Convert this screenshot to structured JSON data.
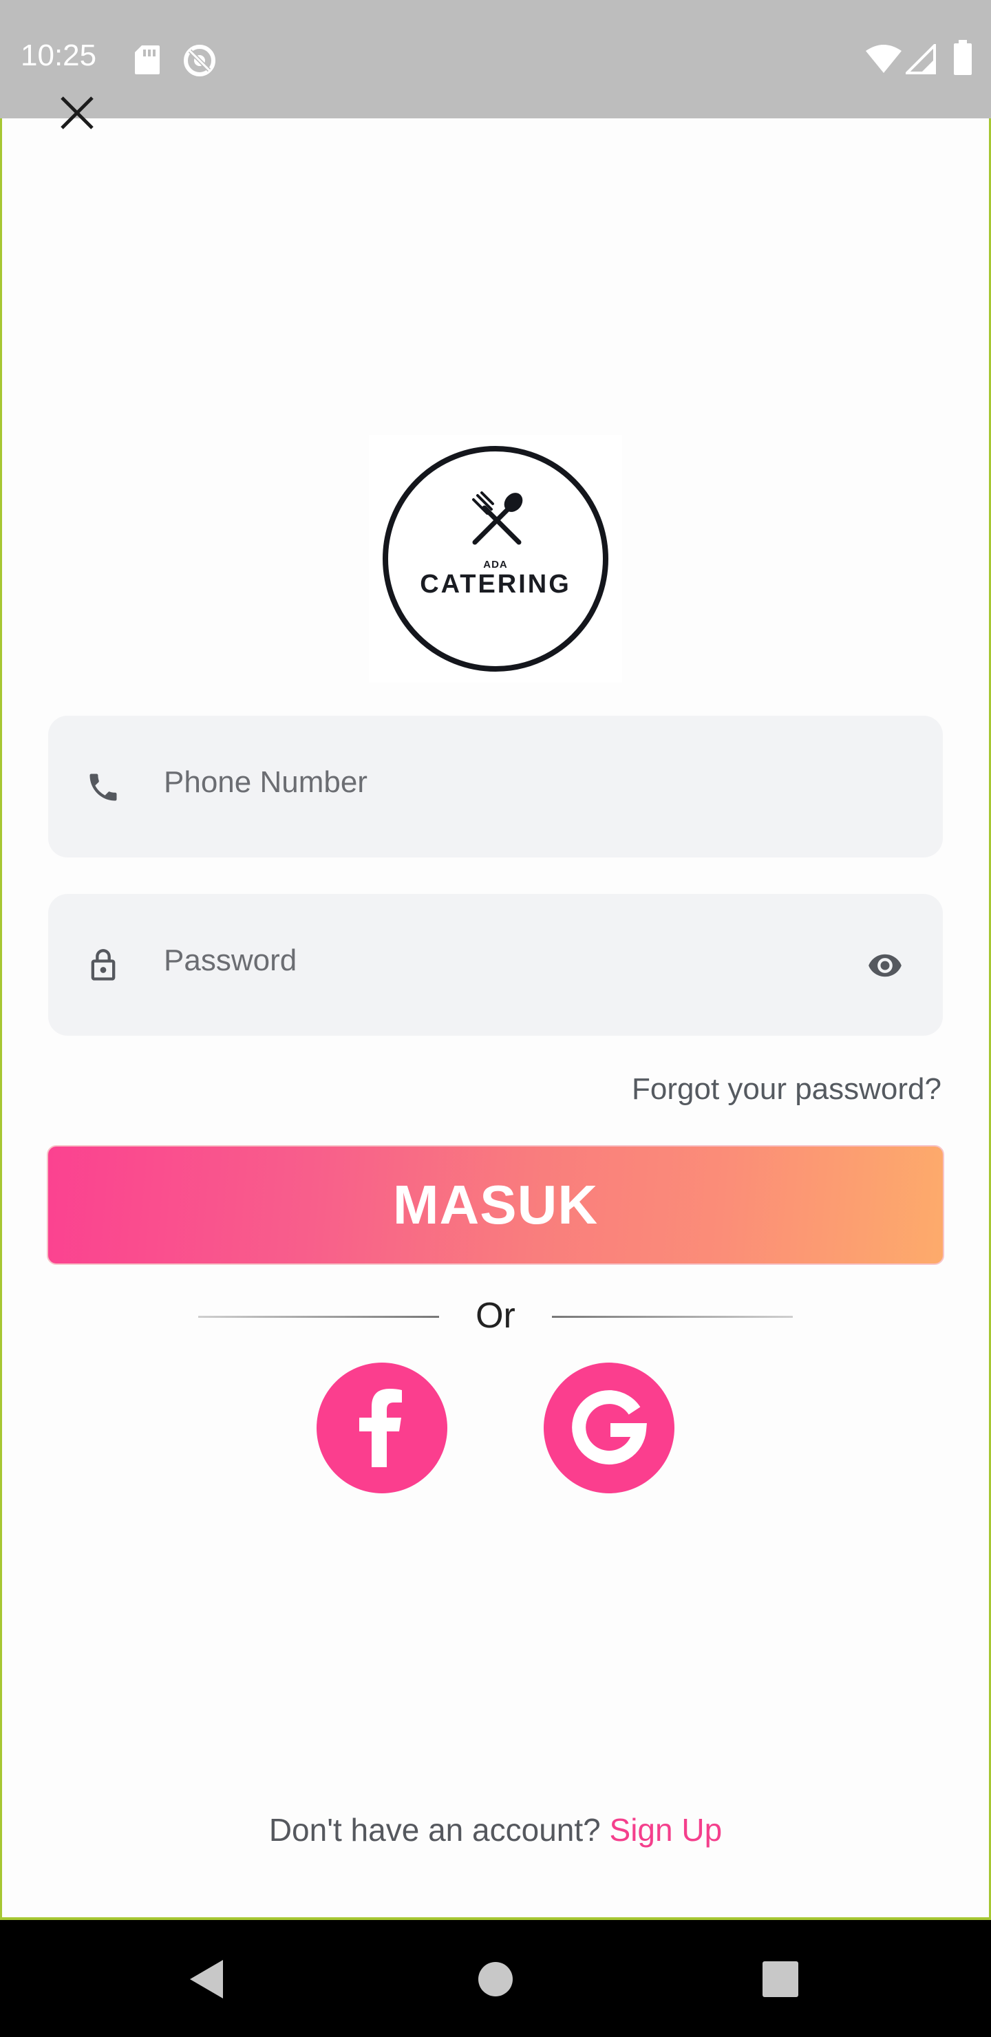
{
  "status_bar": {
    "time": "10:25",
    "icons": [
      "sd-card-icon",
      "do-not-disturb-icon",
      "wifi-icon",
      "signal-icon",
      "battery-icon"
    ]
  },
  "header": {
    "close_icon": "close-icon"
  },
  "logo": {
    "small_text": "ADA",
    "brand": "CATERING",
    "icon": "fork-spoon-icon"
  },
  "form": {
    "phone": {
      "placeholder": "Phone Number",
      "icon": "phone-icon"
    },
    "password": {
      "placeholder": "Password",
      "icon": "lock-icon",
      "toggle_icon": "eye-icon"
    },
    "forgot_label": "Forgot your password?",
    "submit_label": "MASUK"
  },
  "divider": {
    "label": "Or"
  },
  "social": [
    {
      "name": "facebook",
      "icon": "facebook-icon"
    },
    {
      "name": "google",
      "icon": "google-icon"
    }
  ],
  "footer": {
    "prompt": "Don't have an account?",
    "signup_label": "Sign Up"
  },
  "nav_bar": {
    "buttons": [
      "back-icon",
      "home-icon",
      "recents-icon"
    ]
  },
  "colors": {
    "accent": "#fb3e8e",
    "link": "#f43f8c",
    "gradient_start": "#fb4290",
    "gradient_end": "#fdab6b",
    "field_bg": "#f2f3f5",
    "status_bar": "#bdbdbd"
  }
}
